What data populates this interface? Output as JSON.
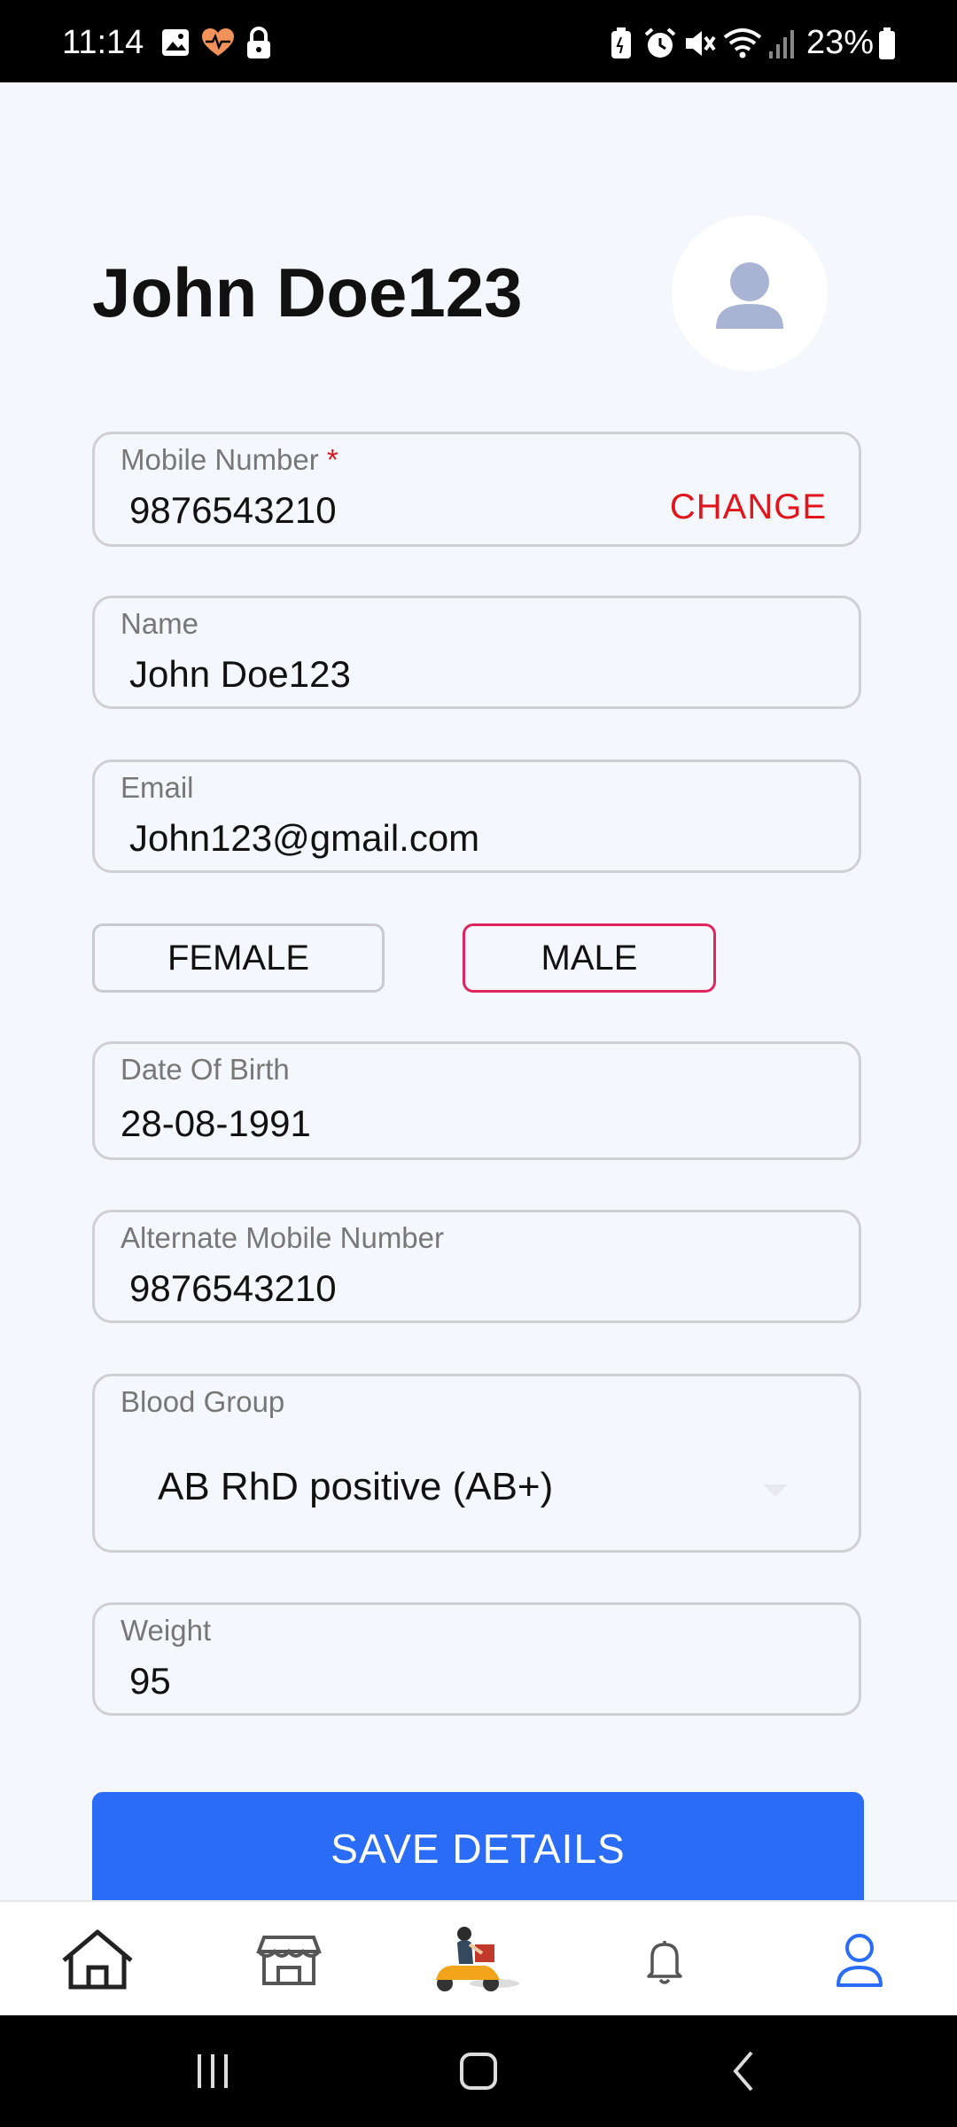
{
  "status_bar": {
    "time": "11:14",
    "battery": "23%",
    "left_icons": [
      "image-icon",
      "heart-rate-icon",
      "lock-icon"
    ],
    "right_icons": [
      "battery-saver-icon",
      "alarm-icon",
      "mute-icon",
      "wifi-icon",
      "signal-icon",
      "battery-icon"
    ]
  },
  "profile": {
    "name": "John Doe123",
    "avatar_icon": "user-avatar-icon"
  },
  "form": {
    "mobile": {
      "label": "Mobile Number",
      "required_mark": "*",
      "value": "9876543210",
      "action": "CHANGE"
    },
    "name": {
      "label": "Name",
      "value": "John Doe123"
    },
    "email": {
      "label": "Email",
      "value": "John123@gmail.com"
    },
    "gender": {
      "female": "FEMALE",
      "male": "MALE",
      "selected": "MALE"
    },
    "dob": {
      "label": "Date Of Birth",
      "value": "28-08-1991"
    },
    "alt_mobile": {
      "label": "Alternate Mobile Number",
      "value": "9876543210"
    },
    "blood_group": {
      "label": "Blood Group",
      "value": "AB RhD positive (AB+)"
    },
    "weight": {
      "label": "Weight",
      "value": "95"
    },
    "save_label": "SAVE DETAILS"
  },
  "bottom_nav": {
    "items": [
      "home-icon",
      "store-icon",
      "delivery-scooter-icon",
      "bell-icon",
      "profile-icon"
    ],
    "active": "profile-icon"
  },
  "colors": {
    "accent": "#2a6cf6",
    "selected_border": "#e0245e",
    "change_text": "#e0161c",
    "background": "#f4f7fc"
  }
}
